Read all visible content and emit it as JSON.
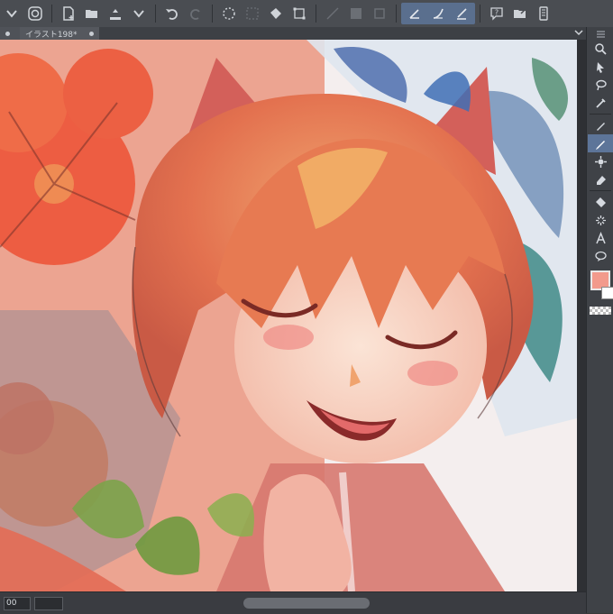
{
  "toolbar": {
    "buttons": [
      "menu-down",
      "app-logo",
      "new-canvas",
      "open-file",
      "save",
      "save-options",
      "undo",
      "redo",
      "selection-spinner",
      "deselect",
      "fill",
      "transform",
      "ruler-snap-1",
      "ruler-snap-2",
      "ruler-snap-3",
      "pen-snap-1",
      "pen-snap-2",
      "pen-snap-3",
      "help",
      "open-folder",
      "device"
    ]
  },
  "tabs": {
    "active_title": "イラスト198*"
  },
  "status": {
    "zoom_value": "00"
  },
  "colors": {
    "main": "#f29a8c",
    "sub": "#ffffff",
    "ui_dark": "#3a3c41",
    "accent": "#5d7599"
  },
  "tool_panel": {
    "tools": [
      "zoom",
      "move",
      "lasso",
      "eyedropper",
      "pen",
      "pencil-active",
      "brush",
      "eraser",
      "fill",
      "gradient",
      "text",
      "balloon"
    ]
  }
}
